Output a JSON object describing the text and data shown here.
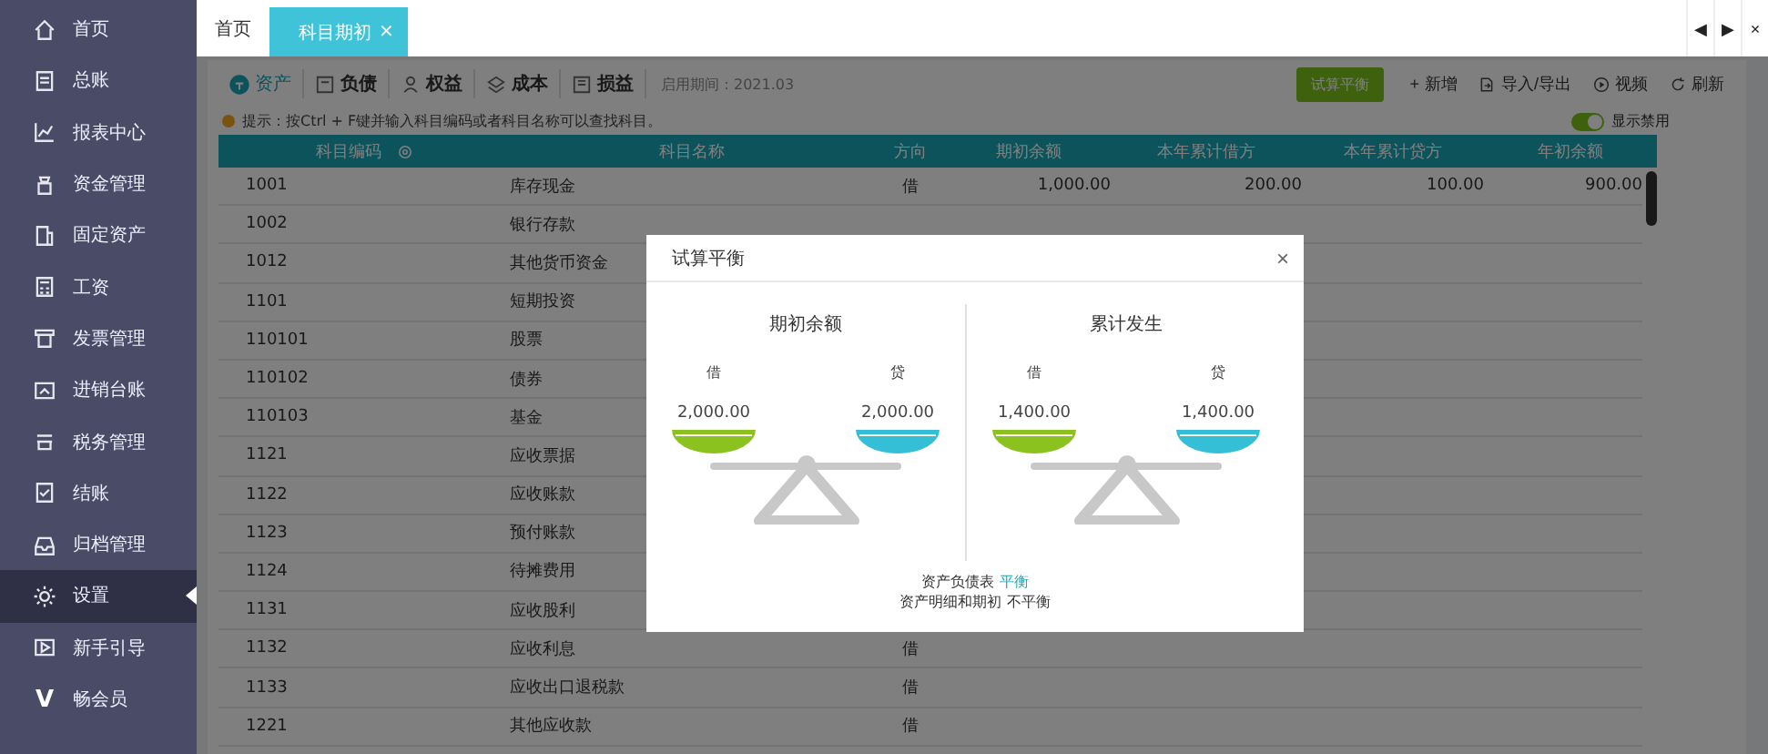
{
  "sidebar": {
    "items": [
      {
        "label": "首页",
        "selected": false
      },
      {
        "label": "总账",
        "selected": false
      },
      {
        "label": "报表中心",
        "selected": false
      },
      {
        "label": "资金管理",
        "selected": false
      },
      {
        "label": "固定资产",
        "selected": false
      },
      {
        "label": "工资",
        "selected": false
      },
      {
        "label": "发票管理",
        "selected": false
      },
      {
        "label": "进销台账",
        "selected": false
      },
      {
        "label": "税务管理",
        "selected": false
      },
      {
        "label": "结账",
        "selected": false
      },
      {
        "label": "归档管理",
        "selected": false
      },
      {
        "label": "设置",
        "selected": true
      },
      {
        "label": "新手引导",
        "selected": false
      },
      {
        "label": "畅会员",
        "selected": false,
        "badge": "V"
      }
    ]
  },
  "top_tabs": [
    {
      "label": "首页",
      "selected": false
    },
    {
      "label": "科目期初",
      "selected": true,
      "close": "×"
    }
  ],
  "window_controls": [
    "◀",
    "▶",
    "×"
  ],
  "category_tabs": [
    {
      "label": "资产",
      "selected": true
    },
    {
      "label": "负债",
      "selected": false
    },
    {
      "label": "权益",
      "selected": false
    },
    {
      "label": "成本",
      "selected": false
    },
    {
      "label": "损益",
      "selected": false
    }
  ],
  "period": "启用期间：2021.03",
  "actions": [
    {
      "label": "试算平衡",
      "kind": "primary"
    },
    {
      "label": "新增",
      "kind": "add",
      "glyph": "+"
    },
    {
      "label": "导入/导出",
      "kind": "transfer"
    },
    {
      "label": "视频",
      "kind": "video"
    },
    {
      "label": "刷新",
      "kind": "refresh"
    }
  ],
  "tip": "提示：按Ctrl + F键并输入科目编码或者科目名称可以查找科目。",
  "show_disabled": {
    "label": "显示禁用",
    "on": true
  },
  "table": {
    "columns": [
      "科目编码",
      "科目名称",
      "方向",
      "期初余额",
      "本年累计借方",
      "本年累计贷方",
      "年初余额"
    ],
    "rows": [
      {
        "code": "1001",
        "name": "库存现金",
        "direction": "借",
        "opening": "1,000.00",
        "debit": "200.00",
        "credit": "100.00",
        "year_start": "900.00"
      },
      {
        "code": "1002",
        "name": "银行存款"
      },
      {
        "code": "1012",
        "name": "其他货币资金"
      },
      {
        "code": "1101",
        "name": "短期投资"
      },
      {
        "code": "110101",
        "name": "股票"
      },
      {
        "code": "110102",
        "name": "债券"
      },
      {
        "code": "110103",
        "name": "基金"
      },
      {
        "code": "1121",
        "name": "应收票据"
      },
      {
        "code": "1122",
        "name": "应收账款"
      },
      {
        "code": "1123",
        "name": "预付账款"
      },
      {
        "code": "1124",
        "name": "待摊费用"
      },
      {
        "code": "1131",
        "name": "应收股利"
      },
      {
        "code": "1132",
        "name": "应收利息",
        "direction": "借"
      },
      {
        "code": "1133",
        "name": "应收出口退税款",
        "direction": "借"
      },
      {
        "code": "1221",
        "name": "其他应收款",
        "direction": "借"
      }
    ]
  },
  "dialog": {
    "title": "试算平衡",
    "close": "×",
    "sections": [
      {
        "title": "期初余额",
        "debit_label": "借",
        "credit_label": "贷",
        "debit": "2,000.00",
        "credit": "2,000.00"
      },
      {
        "title": "累计发生",
        "debit_label": "借",
        "credit_label": "贷",
        "debit": "1,400.00",
        "credit": "1,400.00"
      }
    ],
    "results": [
      {
        "label": "资产负债表",
        "status": "平衡",
        "balanced": true
      },
      {
        "label": "资产明细和期初",
        "status": "不平衡",
        "balanced": false
      }
    ]
  }
}
